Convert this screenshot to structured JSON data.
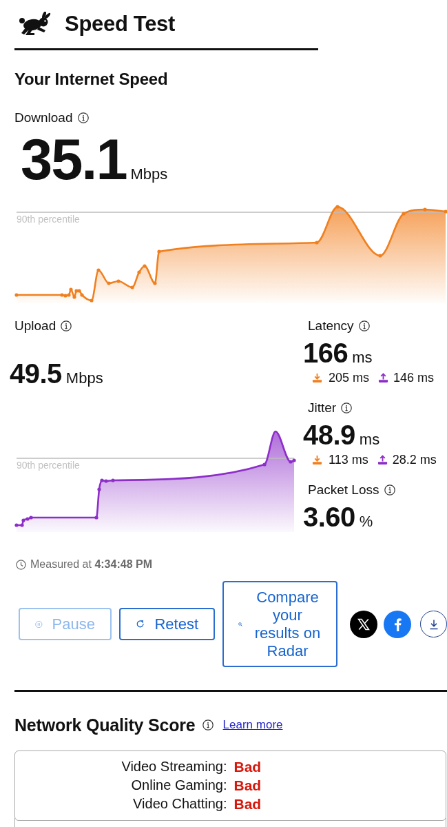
{
  "header": {
    "title": "Speed Test"
  },
  "speed": {
    "heading": "Your Internet Speed",
    "download": {
      "label": "Download",
      "value": "35.1",
      "unit": "Mbps",
      "percentile_label": "90th percentile"
    },
    "upload": {
      "label": "Upload",
      "value": "49.5",
      "unit": "Mbps",
      "percentile_label": "90th percentile"
    },
    "metrics": [
      {
        "label": "Latency",
        "value": "166",
        "unit": "ms",
        "download": "205 ms",
        "upload": "146 ms"
      },
      {
        "label": "Jitter",
        "value": "48.9",
        "unit": "ms",
        "download": "113 ms",
        "upload": "28.2 ms"
      },
      {
        "label": "Packet Loss",
        "value": "3.60",
        "unit": "%"
      }
    ],
    "measured": "Measured at **4:34:48 PM**"
  },
  "actions": {
    "buttons": [
      {
        "kind": "pause",
        "label": "Pause",
        "disabled": true
      },
      {
        "kind": "retest",
        "label": "Retest",
        "disabled": false
      },
      {
        "kind": "compare",
        "label": "Compare your results on Radar",
        "disabled": false
      }
    ]
  },
  "network_quality": {
    "title": "Network Quality Score",
    "link": "Learn more",
    "rows": [
      {
        "label": "Video Streaming:",
        "rating": "Bad"
      },
      {
        "label": "Online Gaming:",
        "rating": "Bad"
      },
      {
        "label": "Video Chatting:",
        "rating": "Bad"
      }
    ]
  }
}
